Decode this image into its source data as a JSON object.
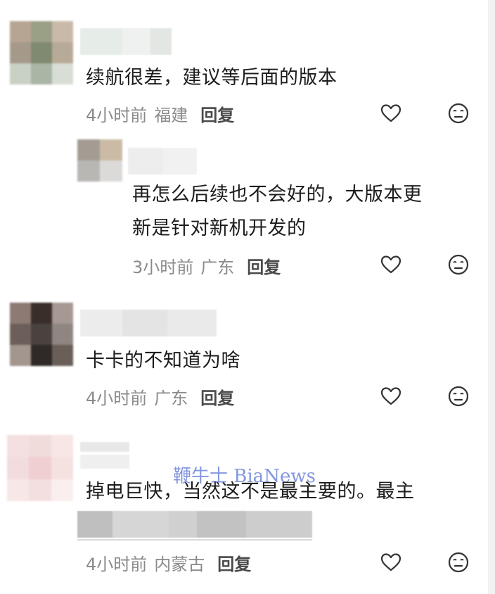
{
  "comments": [
    {
      "text": "续航很差，建议等后面的版本",
      "time": "4小时前",
      "location": "福建",
      "reply_label": "回复"
    },
    {
      "text_line1": "再怎么后续也不会好的，大版本更",
      "text_line2": "新是针对新机开发的",
      "time": "3小时前",
      "location": "广东",
      "reply_label": "回复"
    },
    {
      "text": "卡卡的不知道为啥",
      "time": "4小时前",
      "location": "广东",
      "reply_label": "回复"
    },
    {
      "text": "掉电巨快，当然这不是最主要的。最主",
      "time": "4小时前",
      "location": "内蒙古",
      "reply_label": "回复"
    }
  ],
  "watermark": "鞭牛士 BiaNews",
  "icons": {
    "like": "heart-icon",
    "dislike": "meh-face-icon"
  },
  "colors": {
    "meta": "#8a8a8a",
    "text": "#1c1c1c",
    "watermark": "#5a74d6"
  }
}
